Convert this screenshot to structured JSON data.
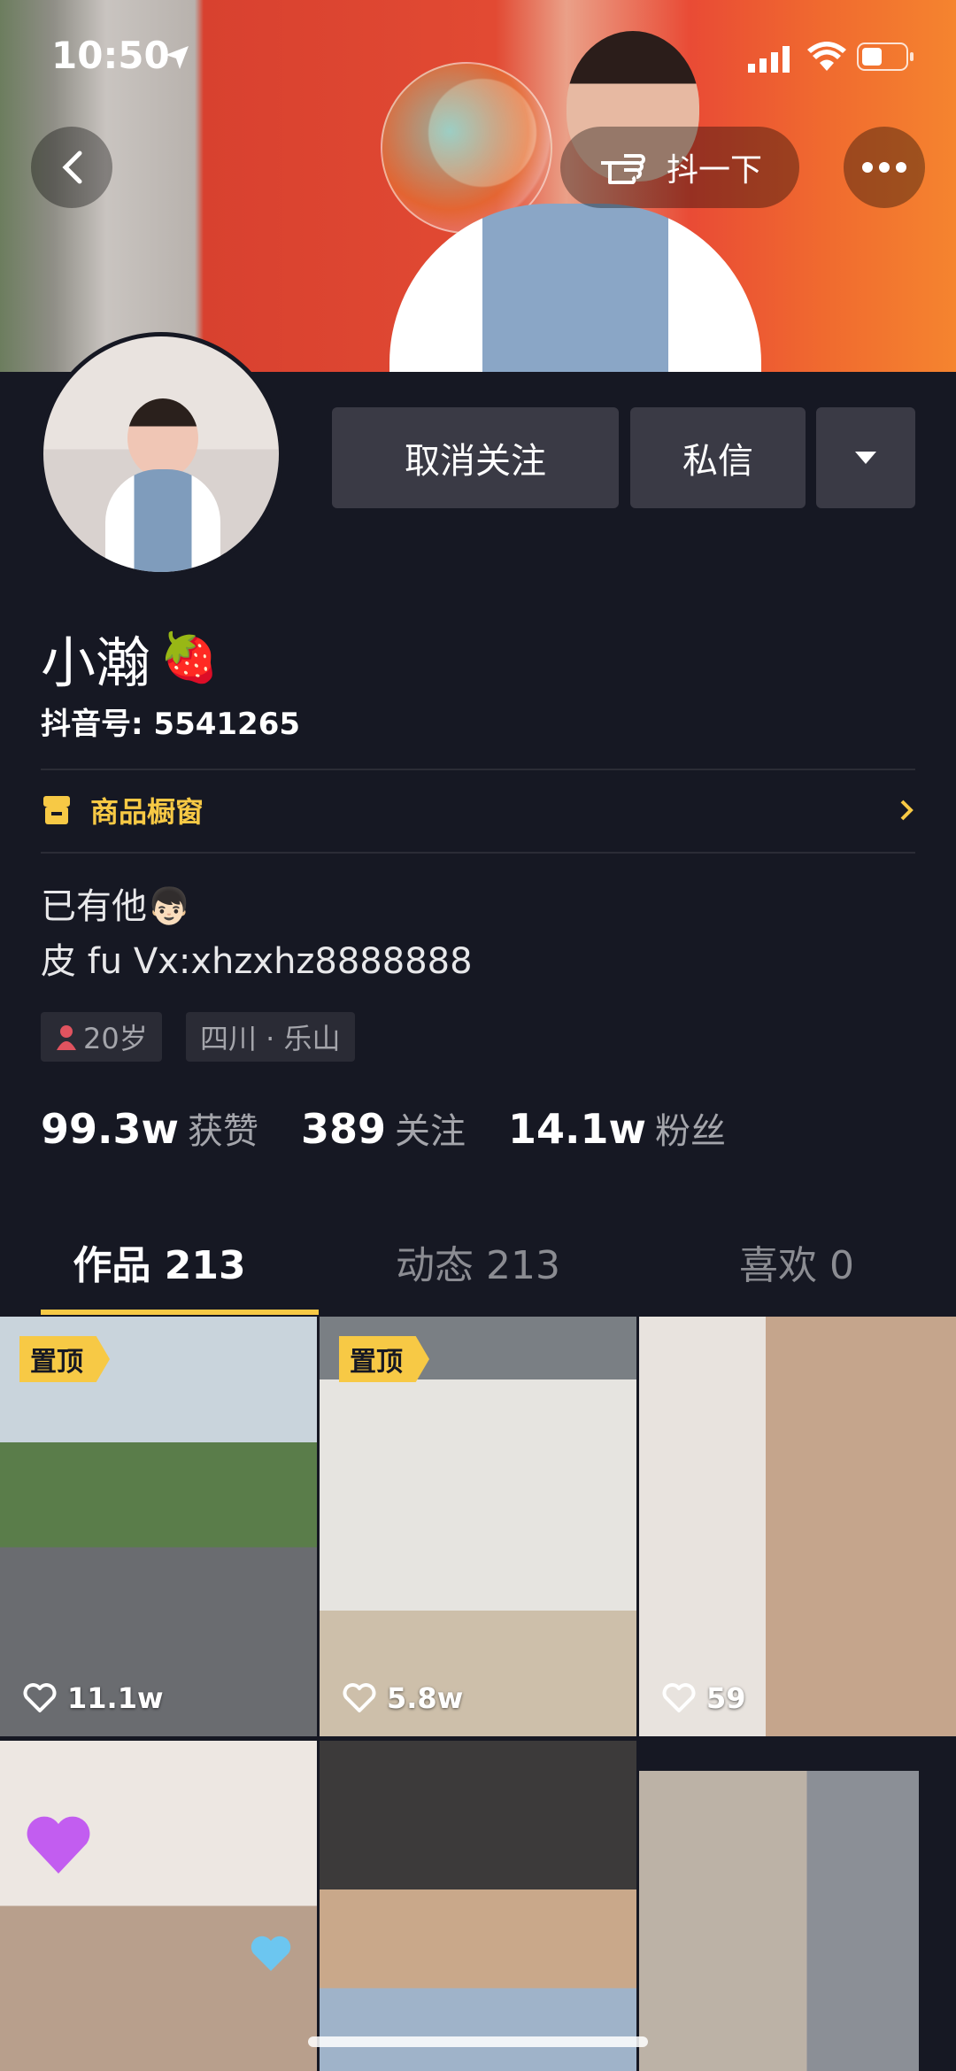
{
  "status_bar": {
    "time": "10:50"
  },
  "header": {
    "shake_label": "抖一下"
  },
  "profile": {
    "unfollow_label": "取消关注",
    "message_label": "私信",
    "name": "小瀚",
    "name_emoji": "🍓",
    "douyin_id": "抖音号: 5541265",
    "shop_label": "商品橱窗",
    "bio_line1": "已有他",
    "bio_line1_emoji": "👦🏻",
    "bio_line2": "皮 fu Vx:xhzxhz8888888",
    "age_tag": "20岁",
    "location_tag": "四川 · 乐山",
    "likes_num": "99.3w",
    "likes_label": "获赞",
    "following_num": "389",
    "following_label": "关注",
    "fans_num": "14.1w",
    "fans_label": "粉丝"
  },
  "tabs": [
    {
      "label": "作品 213"
    },
    {
      "label": "动态 213"
    },
    {
      "label": "喜欢 0"
    }
  ],
  "videos": [
    {
      "pinned": "置顶",
      "likes": "11.1w"
    },
    {
      "pinned": "置顶",
      "likes": "5.8w"
    },
    {
      "likes": "59"
    }
  ]
}
